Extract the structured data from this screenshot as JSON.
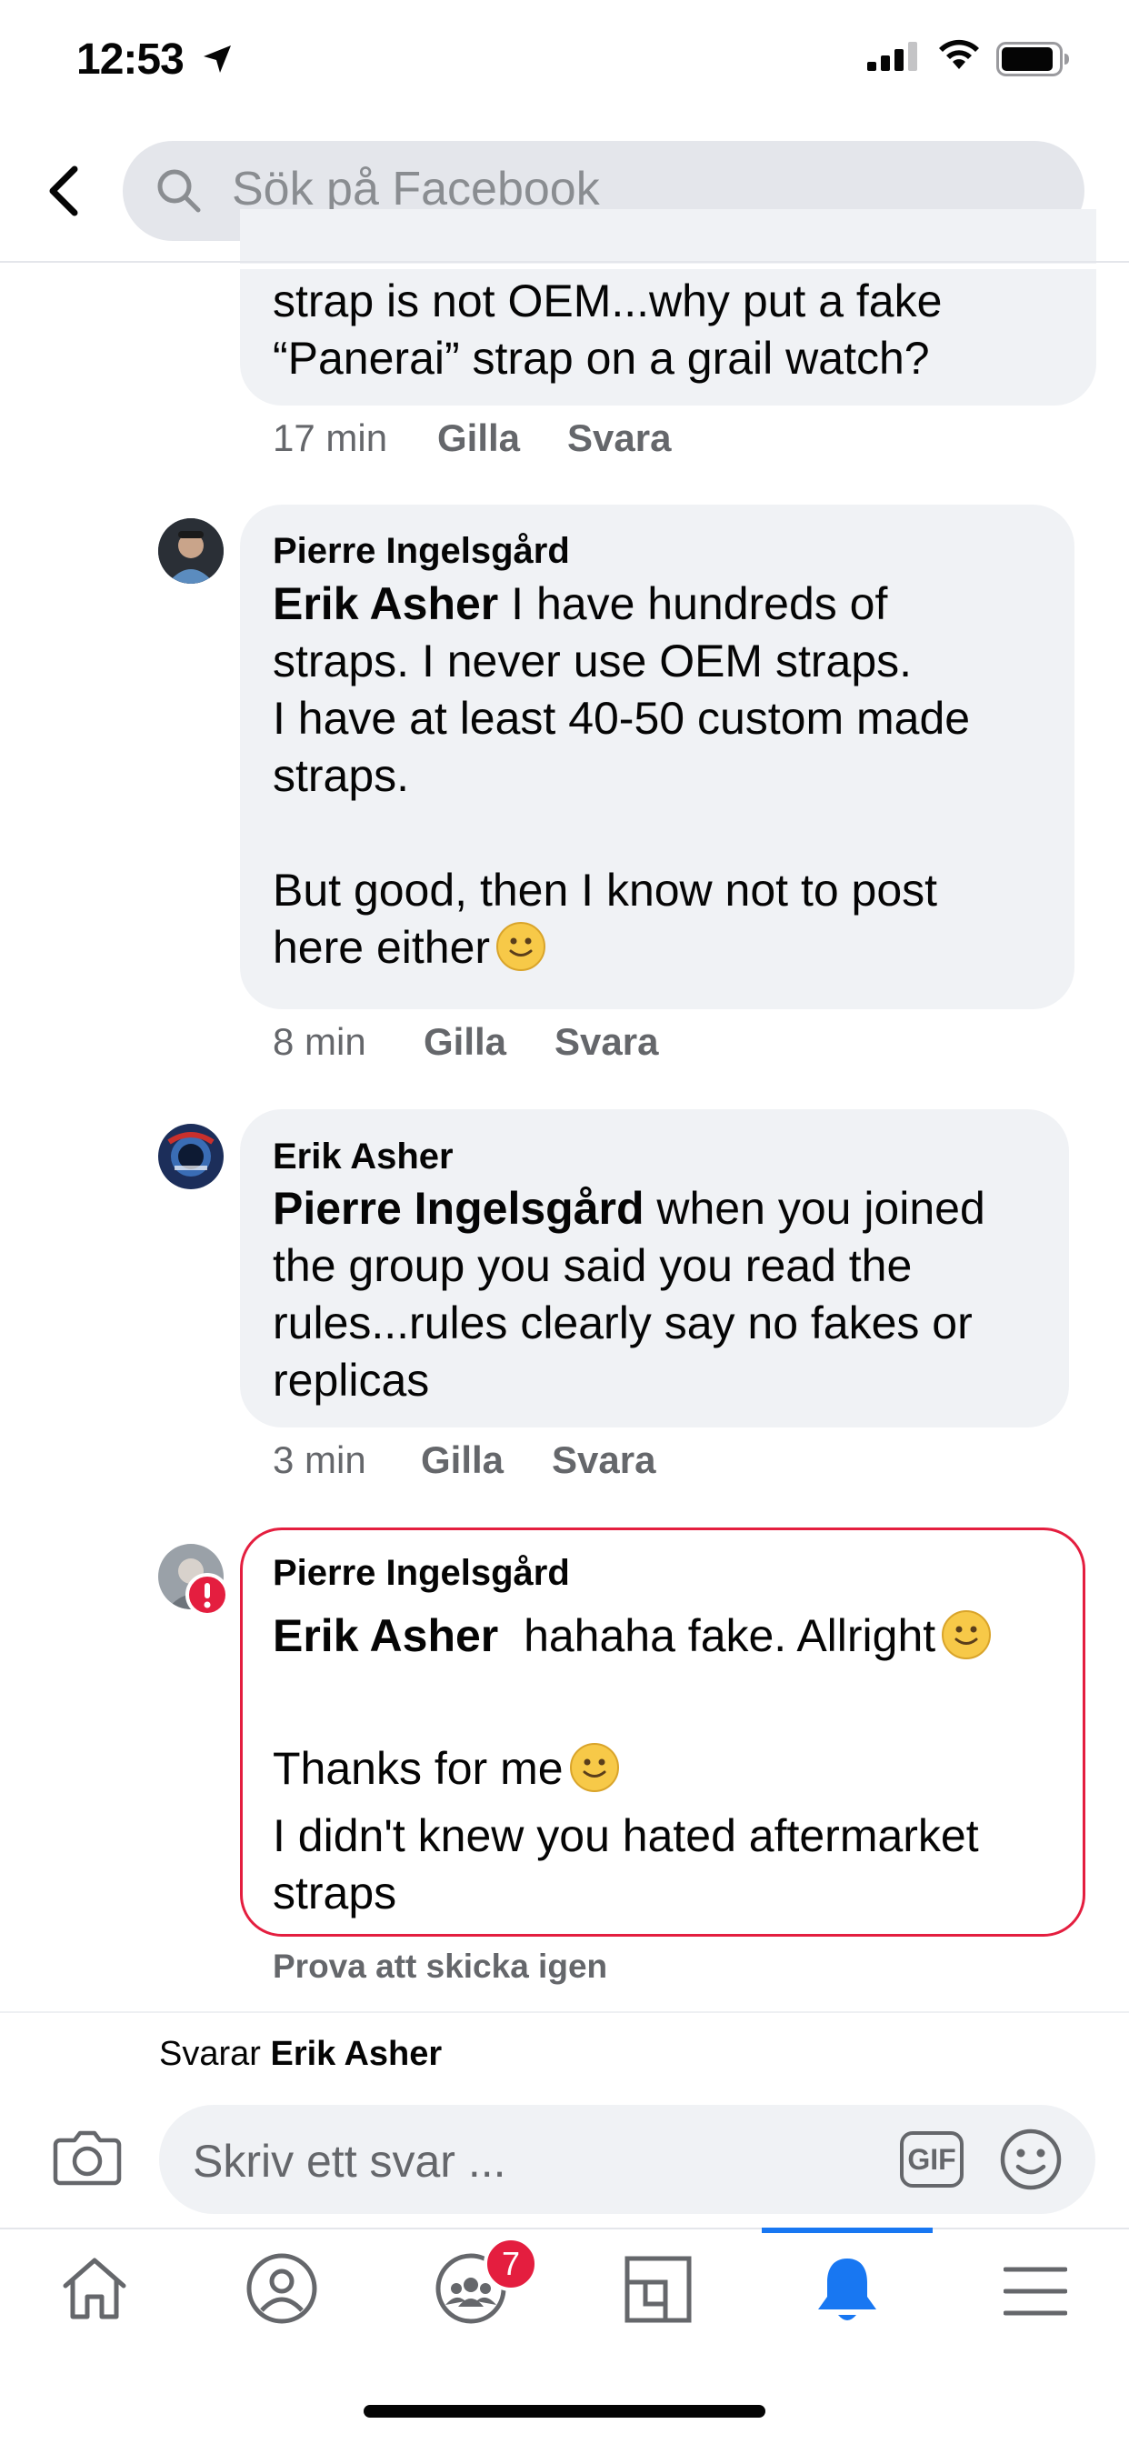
{
  "status_bar": {
    "time": "12:53"
  },
  "search": {
    "placeholder": "Sök på Facebook"
  },
  "comments": [
    {
      "partial_text": "strap is not OEM...why put a fake\n“Panerai” strap on a grail watch?",
      "time": "17 min",
      "like": "Gilla",
      "reply": "Svara"
    },
    {
      "author": "Pierre Ingelsgård",
      "mention": "Erik Asher",
      "text": " I have hundreds of\nstraps. I never use OEM straps.\nI have at least 40-50 custom made\nstraps.\n\nBut good, then I know not to post\nhere either",
      "time": "8 min",
      "like": "Gilla",
      "reply": "Svara"
    },
    {
      "author": "Erik Asher",
      "mention": "Pierre Ingelsgård",
      "text": " when you joined\nthe group you said you read the\nrules...rules clearly say no fakes or\nreplicas",
      "time": "3 min",
      "like": "Gilla",
      "reply": "Svara"
    },
    {
      "author": "Pierre Ingelsgård",
      "mention": "Erik Asher",
      "text_line1": "  hahaha fake. Allright",
      "text_line2": "Thanks for me",
      "text_line3": "I didn't knew you hated aftermarket\nstraps",
      "status": "Prova att skicka igen"
    }
  ],
  "reply_context": {
    "prefix": "Svarar",
    "name": "Erik Asher"
  },
  "composer": {
    "placeholder": "Skriv ett svar ...",
    "gif_label": "GIF"
  },
  "tab_bar": {
    "groups_badge": "7"
  },
  "colors": {
    "accent": "#1877f2",
    "error": "#e41e3f",
    "bubble": "#f0f2f5",
    "secondary_text": "#65676b"
  }
}
